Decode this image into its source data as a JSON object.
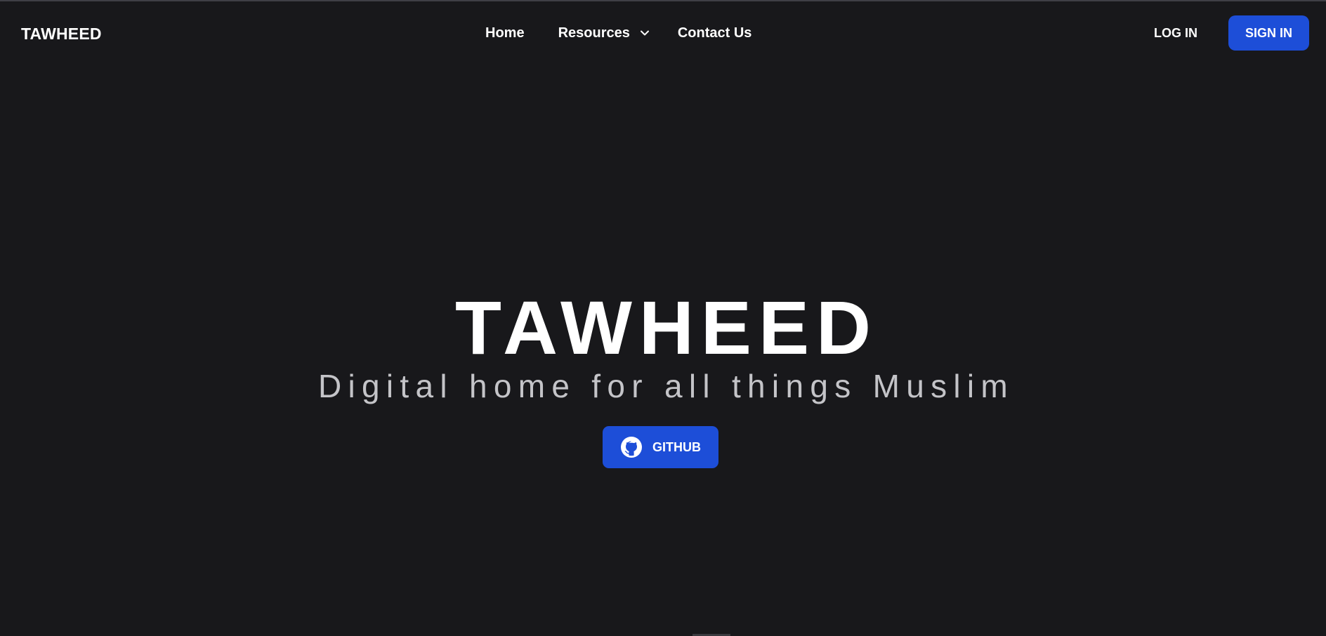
{
  "header": {
    "brand": "TAWHEED",
    "nav": {
      "home": "Home",
      "resources": "Resources",
      "contact": "Contact Us"
    },
    "auth": {
      "login": "LOG IN",
      "signin": "SIGN IN"
    },
    "icons": {
      "resources_dropdown": "chevron-down-icon"
    }
  },
  "hero": {
    "title": "TAWHEED",
    "subtitle": "Digital home for all things Muslim",
    "github_button": "GITHUB",
    "github_icon": "github-icon"
  },
  "colors": {
    "background": "#18181b",
    "accent": "#1d4ed8",
    "text": "#ffffff",
    "subtitle": "#c4c4c8"
  }
}
